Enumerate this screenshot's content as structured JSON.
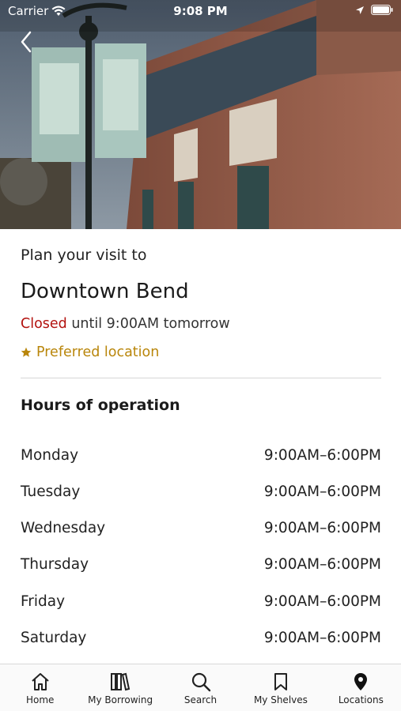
{
  "status_bar": {
    "carrier": "Carrier",
    "time": "9:08 PM"
  },
  "header": {
    "back_icon": "chevron-left-icon"
  },
  "location": {
    "plan_label": "Plan your visit to",
    "name": "Downtown Bend",
    "status_closed": "Closed",
    "status_rest": " until 9:00AM tomorrow",
    "preferred_label": "Preferred location",
    "preferred_color": "#b9860b",
    "closed_color": "#b3120f"
  },
  "hours": {
    "title": "Hours of operation",
    "rows": [
      {
        "day": "Monday",
        "time": "9:00AM–6:00PM"
      },
      {
        "day": "Tuesday",
        "time": "9:00AM–6:00PM"
      },
      {
        "day": "Wednesday",
        "time": "9:00AM–6:00PM"
      },
      {
        "day": "Thursday",
        "time": "9:00AM–6:00PM"
      },
      {
        "day": "Friday",
        "time": "9:00AM–6:00PM"
      },
      {
        "day": "Saturday",
        "time": "9:00AM–6:00PM"
      }
    ]
  },
  "tab_bar": {
    "tabs": [
      {
        "label": "Home",
        "icon": "home-icon"
      },
      {
        "label": "My Borrowing",
        "icon": "books-icon"
      },
      {
        "label": "Search",
        "icon": "search-icon"
      },
      {
        "label": "My Shelves",
        "icon": "bookmark-icon"
      },
      {
        "label": "Locations",
        "icon": "location-pin-icon"
      }
    ]
  }
}
